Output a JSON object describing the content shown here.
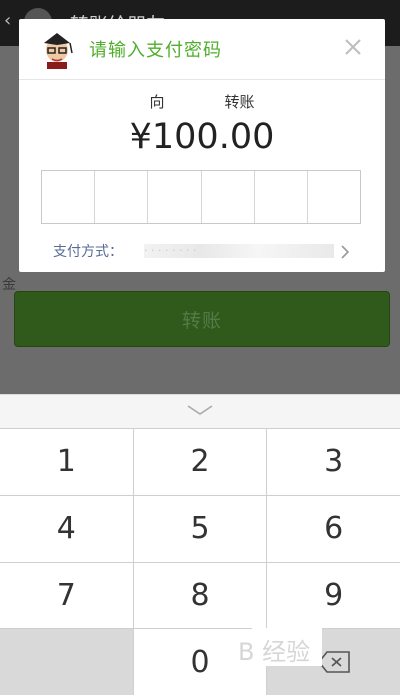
{
  "background": {
    "header_title": "转账给朋友",
    "edge_char": "金",
    "transfer_button_label": "转账"
  },
  "dialog": {
    "title": "请输入支付密码",
    "to_prefix": "向",
    "to_suffix": "转账",
    "amount": "¥100.00",
    "password_cells": 6,
    "payment_method_label": "支付方式：",
    "payment_method_value": "· · · · · · · ·"
  },
  "keypad": {
    "keys": [
      "1",
      "2",
      "3",
      "4",
      "5",
      "6",
      "7",
      "8",
      "9",
      "",
      "0",
      "⌫"
    ]
  },
  "watermark": {
    "text": "B 经验"
  },
  "colors": {
    "accent_green": "#4fae2a",
    "link_blue": "#576b95",
    "button_green": "#2f5a1c"
  }
}
